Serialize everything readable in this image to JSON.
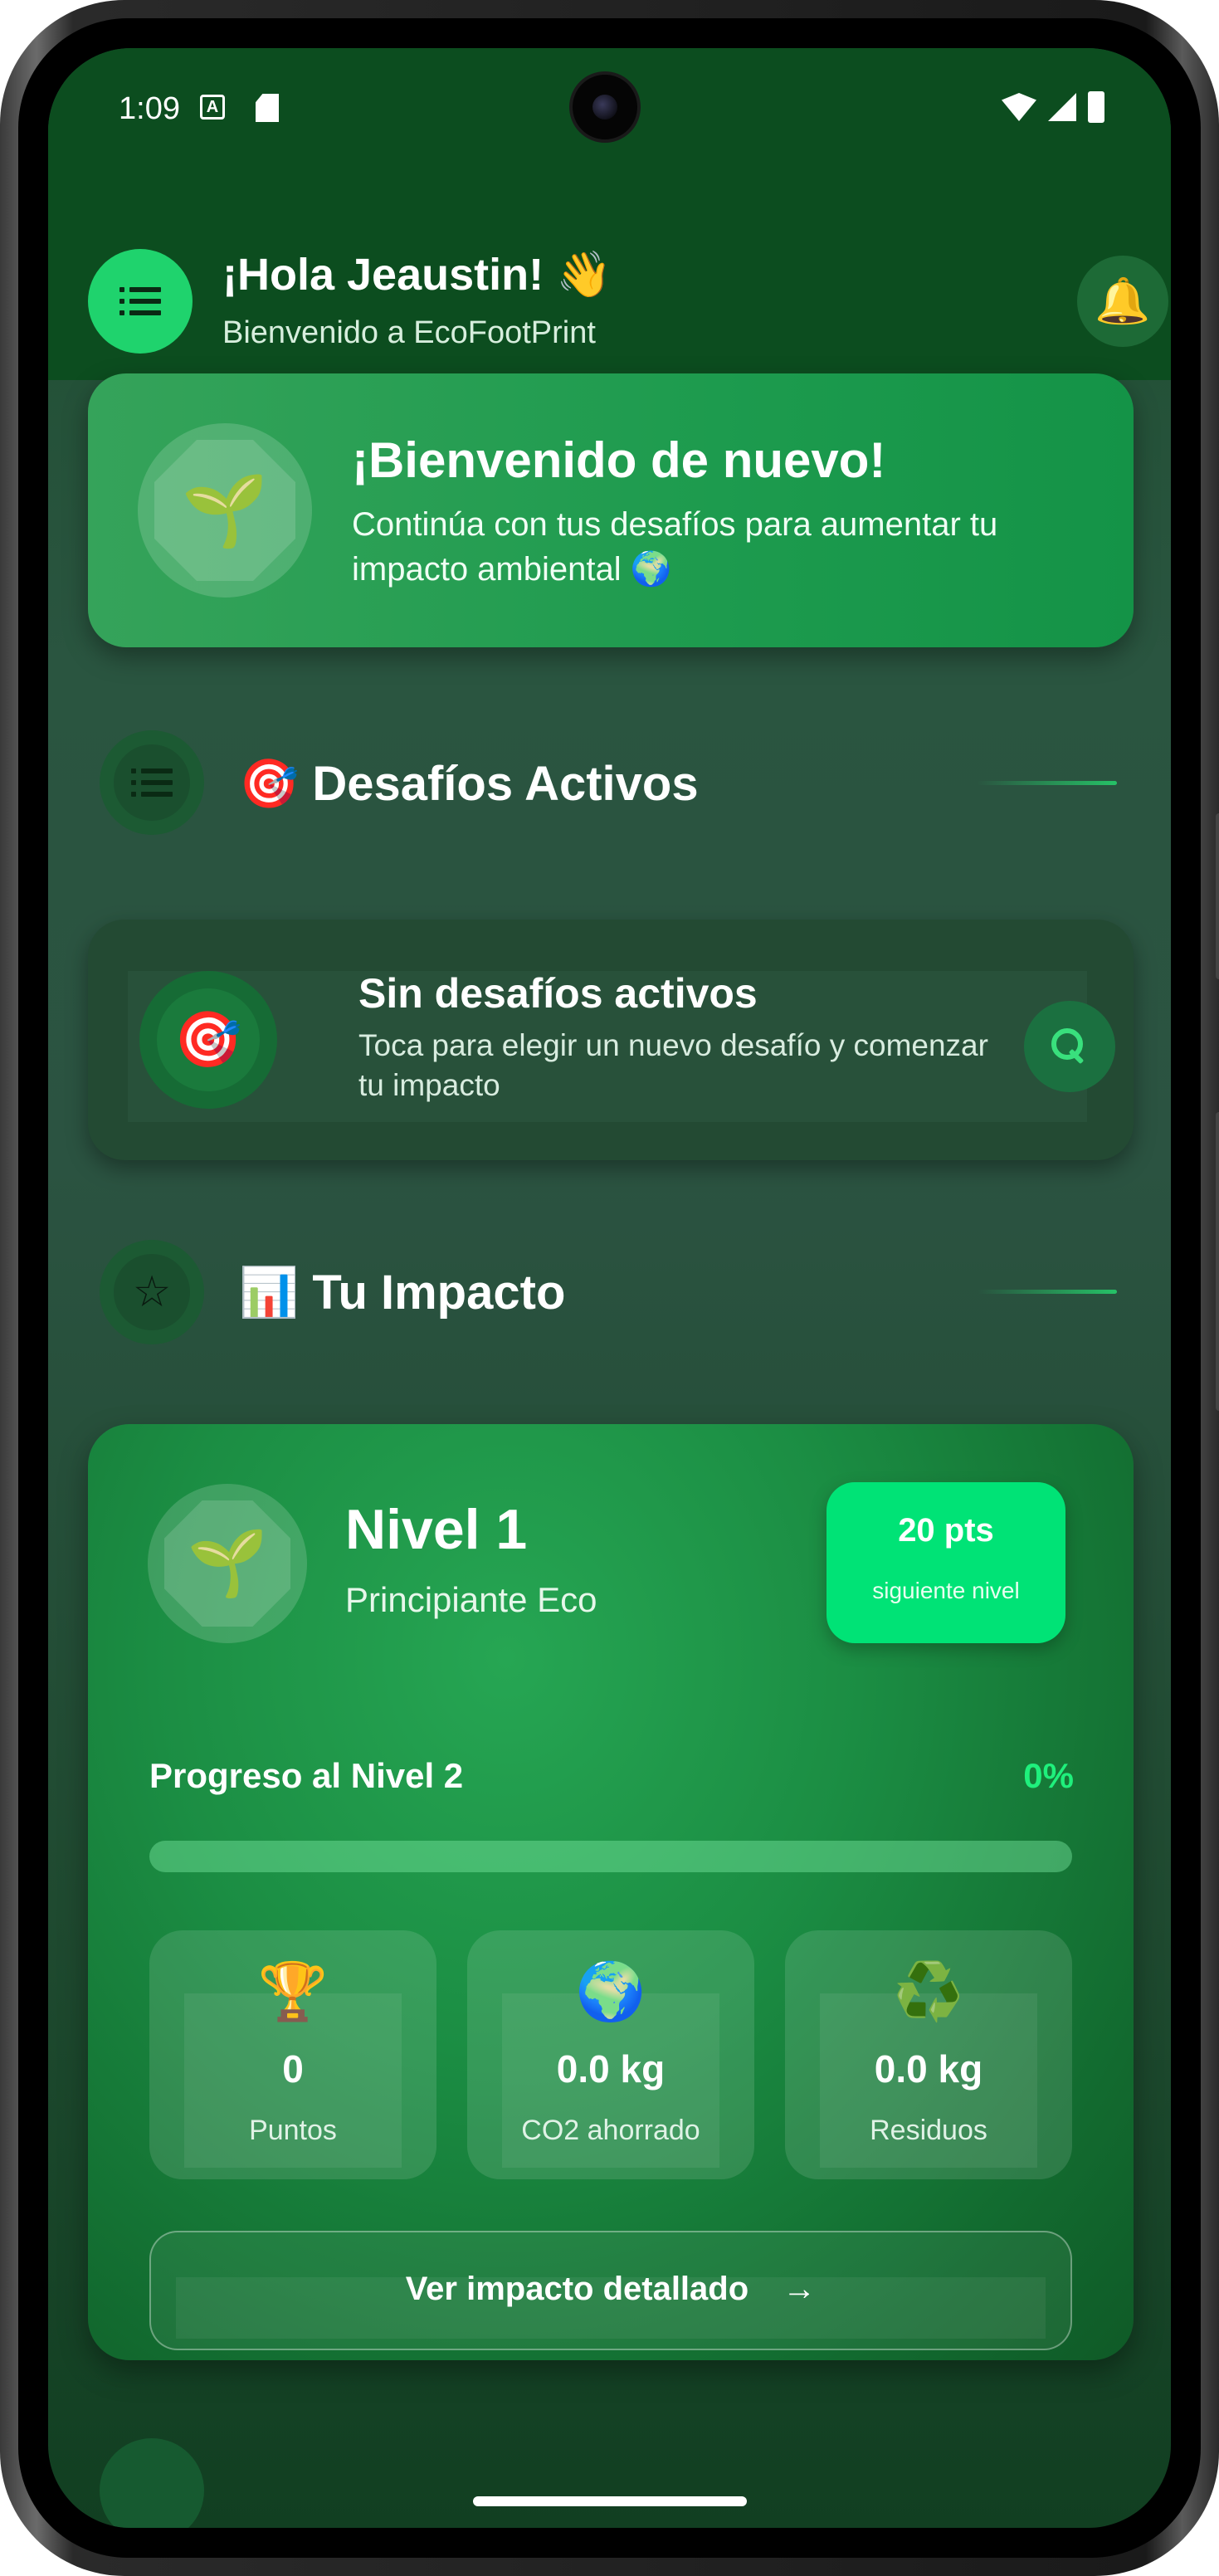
{
  "status_bar": {
    "time": "1:09",
    "icons": [
      "a-notification-icon",
      "sd-card-icon",
      "wifi-icon",
      "signal-icon",
      "battery-icon"
    ]
  },
  "header": {
    "greeting": "¡Hola Jeaustin! 👋",
    "subtitle": "Bienvenido a EcoFootPrint",
    "menu_icon": "list-icon",
    "notification_icon": "🔔"
  },
  "welcome_card": {
    "icon": "🌱",
    "title": "¡Bienvenido de nuevo!",
    "text": "Continúa con tus desafíos para aumentar tu impacto ambiental 🌍"
  },
  "active_challenges": {
    "title": "🎯 Desafíos Activos",
    "icon": "list-icon",
    "empty_state": {
      "icon": "🎯",
      "title": "Sin desafíos activos",
      "text": "Toca para elegir un nuevo desafío y comenzar tu impacto",
      "action_icon": "search-icon"
    }
  },
  "impact": {
    "title": "📊 Tu Impacto",
    "section_icon": "☆",
    "level": {
      "icon": "🌱",
      "title": "Nivel 1",
      "subtitle": "Principiante Eco",
      "points_badge_value": "20 pts",
      "points_badge_label": "siguiente nivel"
    },
    "progress": {
      "label": "Progreso al Nivel 2",
      "percent_text": "0%",
      "fraction": 0
    },
    "stats": [
      {
        "icon": "🏆",
        "value": "0",
        "label": "Puntos"
      },
      {
        "icon": "🌍",
        "value": "0.0 kg",
        "label": "CO2 ahorrado"
      },
      {
        "icon": "♻️",
        "value": "0.0 kg",
        "label": "Residuos"
      }
    ],
    "detail_button": {
      "label": "Ver impacto detallado",
      "arrow": "→"
    }
  },
  "colors": {
    "header_bg": "#0c4d1f",
    "accent_green": "#00e376",
    "fab_green": "#1fd36d"
  }
}
